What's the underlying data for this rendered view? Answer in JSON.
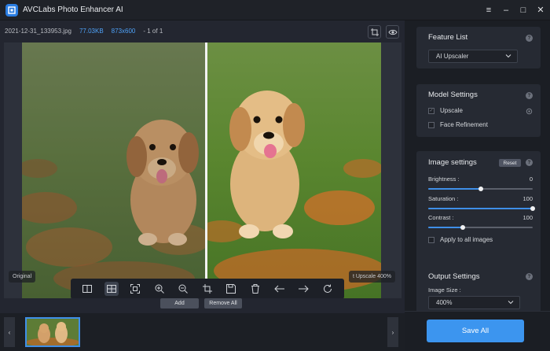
{
  "window": {
    "title": "AVCLabs Photo Enhancer AI",
    "controls": {
      "menu": "≡",
      "minimize": "–",
      "maximize": "□",
      "close": "✕"
    }
  },
  "file_info": {
    "name": "2021-12-31_133953.jpg",
    "size": "77.03KB",
    "dimensions": "873x600",
    "count": "- 1 of 1"
  },
  "viewer": {
    "label_left": "Original",
    "label_right": "t Upscale 400%"
  },
  "actions": {
    "add": "Add",
    "remove_all": "Remove All"
  },
  "feature_list": {
    "title": "Feature List",
    "selected": "AI Upscaler"
  },
  "model_settings": {
    "title": "Model Settings",
    "upscale": "Upscale",
    "face_refinement": "Face Refinement"
  },
  "image_settings": {
    "title": "Image settings",
    "reset": "Reset",
    "brightness_label": "Brightness :",
    "brightness_value": "0",
    "brightness_level": 0.5,
    "saturation_label": "Saturation :",
    "saturation_value": "100",
    "saturation_level": 1.0,
    "contrast_label": "Contrast :",
    "contrast_value": "100",
    "contrast_level": 0.333,
    "apply_all": "Apply to all images"
  },
  "output_settings": {
    "title": "Output Settings",
    "image_size_label": "Image Size :",
    "image_size": "400%"
  },
  "save_all": "Save All",
  "colors": {
    "accent": "#3c95ef",
    "info_blue": "#4ea1f7",
    "background": "#1b1e24"
  }
}
